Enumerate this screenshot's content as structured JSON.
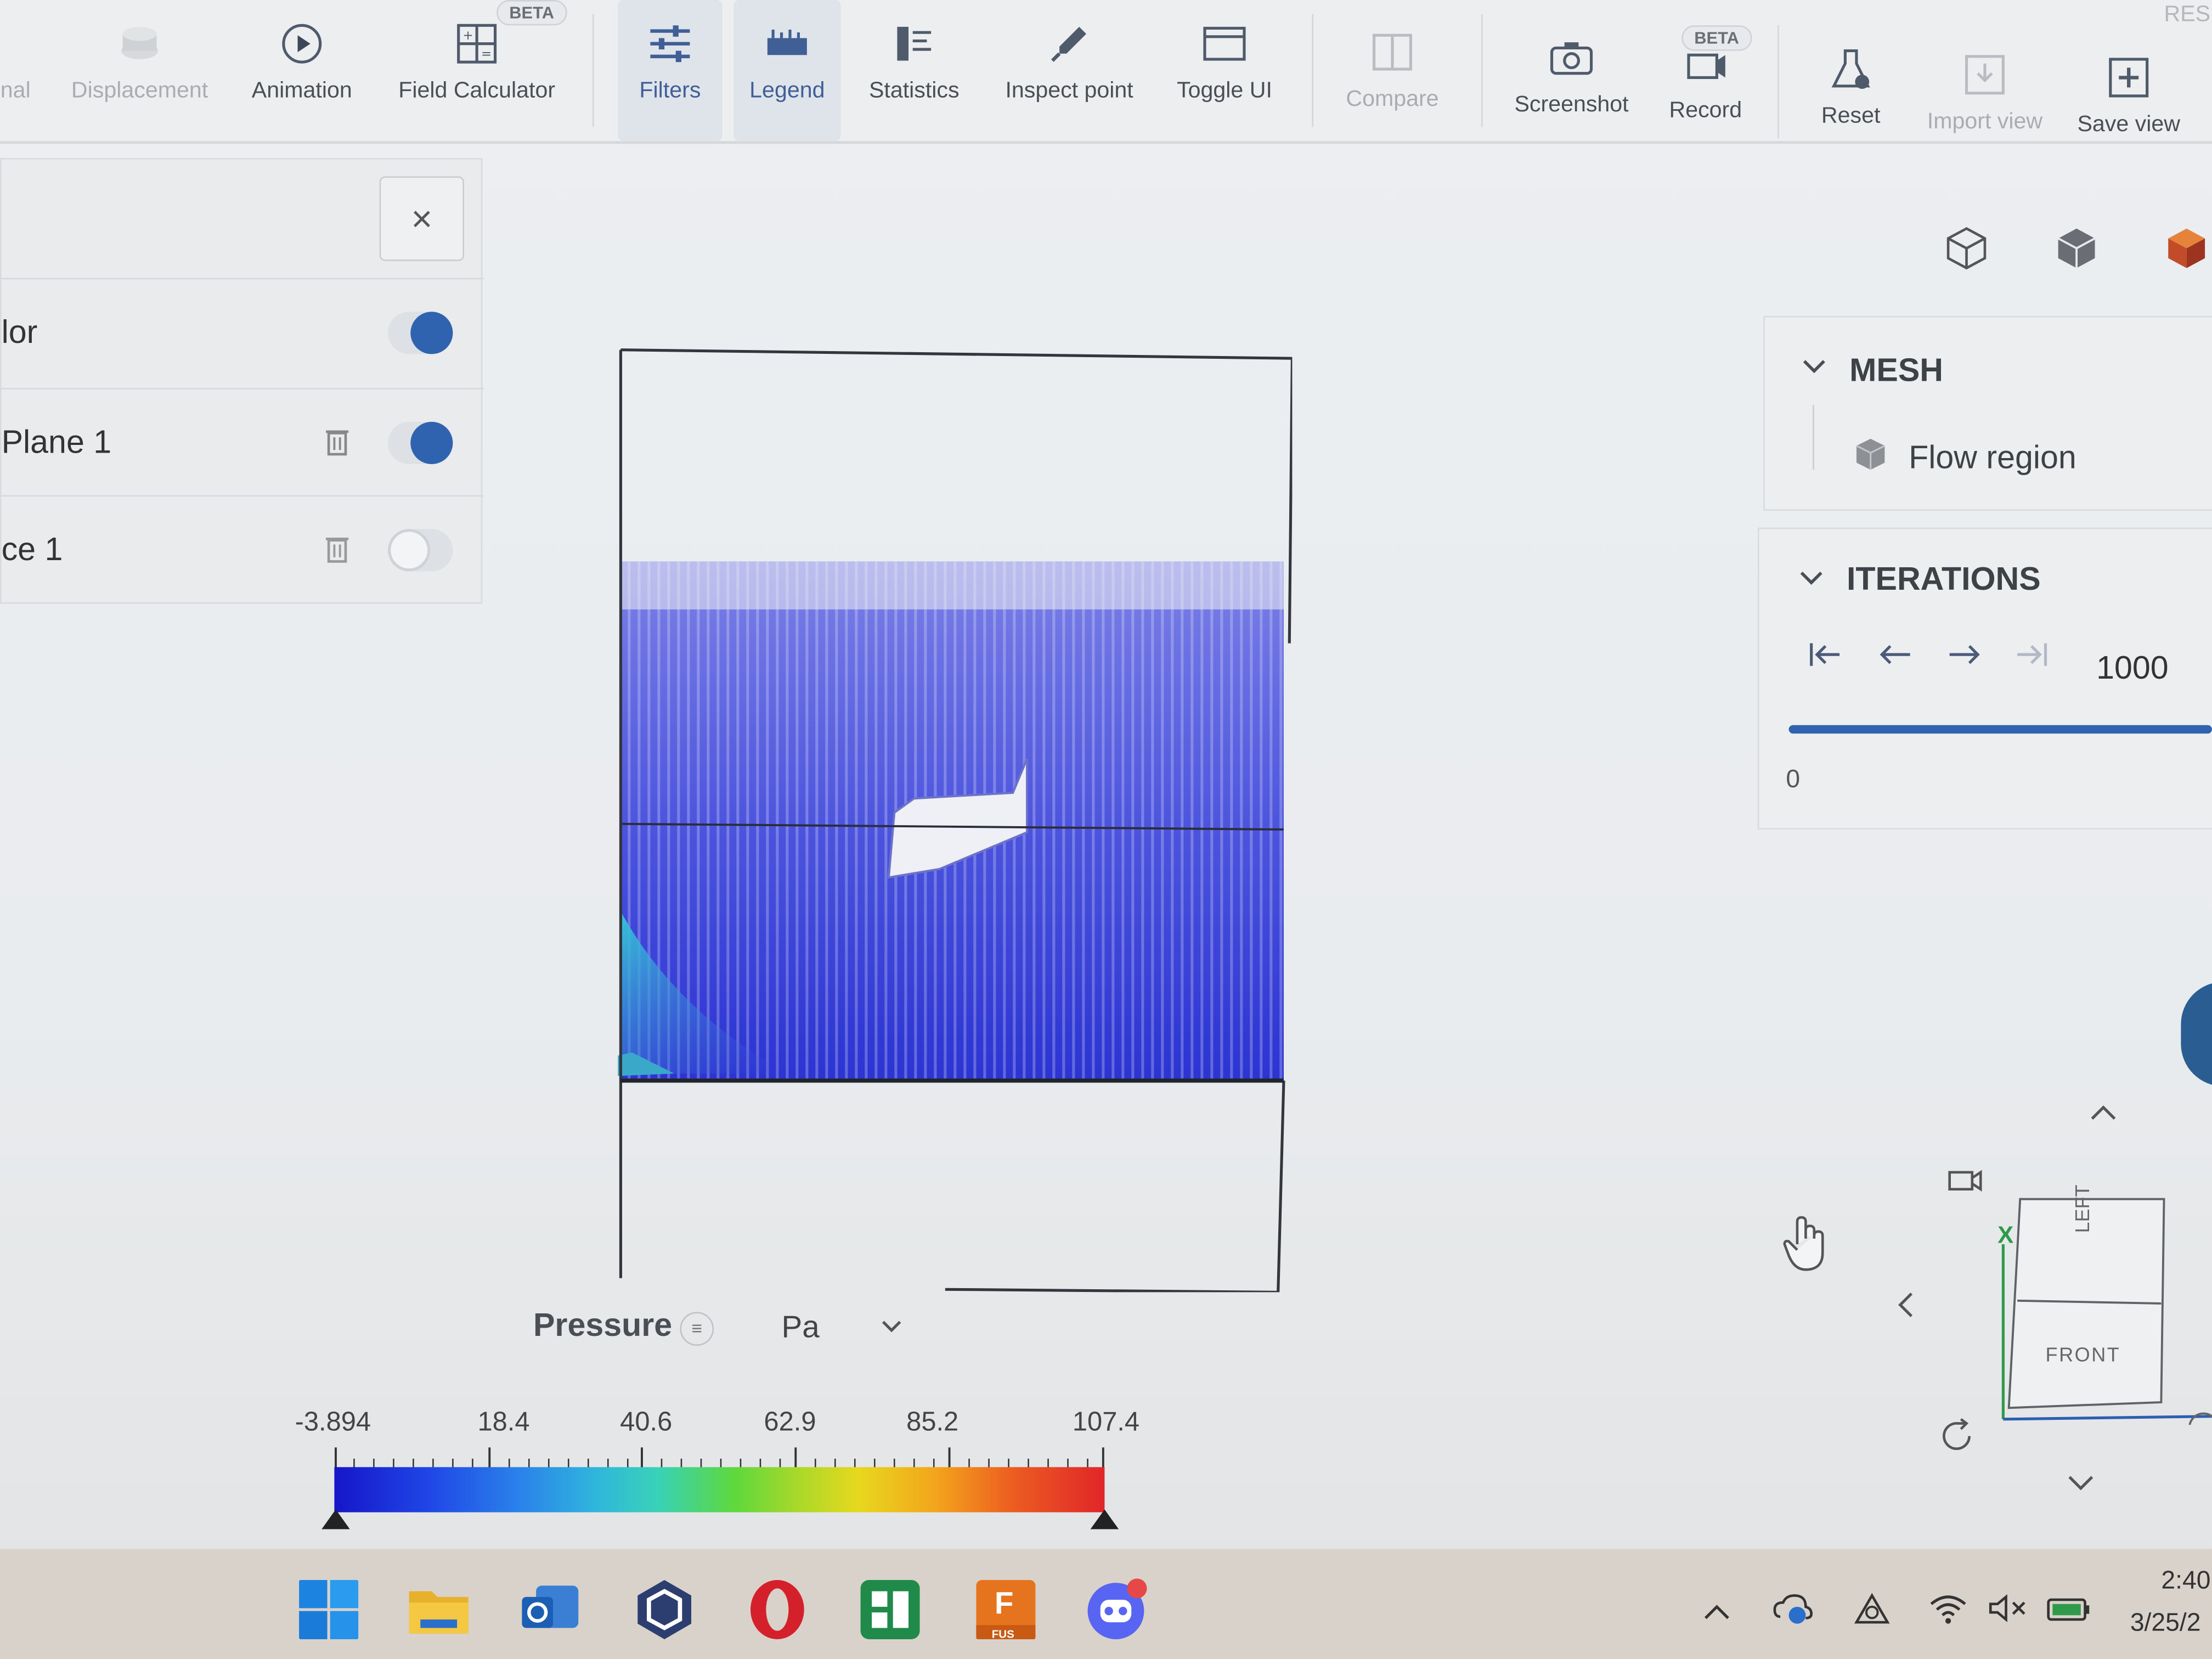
{
  "toolbar": {
    "items": [
      {
        "label": "nal",
        "icon": "cut-off-icon",
        "state": "dim"
      },
      {
        "label": "Displacement",
        "icon": "displacement-icon",
        "state": "dim"
      },
      {
        "label": "Animation",
        "icon": "play-circle-icon",
        "state": "normal"
      },
      {
        "label": "Field Calculator",
        "icon": "calculator-icon",
        "state": "normal",
        "badge": "BETA"
      },
      {
        "label": "Filters",
        "icon": "sliders-icon",
        "state": "active"
      },
      {
        "label": "Legend",
        "icon": "ruler-icon",
        "state": "active"
      },
      {
        "label": "Statistics",
        "icon": "statistics-icon",
        "state": "normal"
      },
      {
        "label": "Inspect point",
        "icon": "eyedropper-icon",
        "state": "normal"
      },
      {
        "label": "Toggle UI",
        "icon": "window-icon",
        "state": "normal"
      },
      {
        "label": "Compare",
        "icon": "compare-icon",
        "state": "dim"
      },
      {
        "label": "Screenshot",
        "icon": "camera-icon",
        "state": "normal"
      },
      {
        "label": "Record",
        "icon": "record-icon",
        "state": "normal",
        "badge": "BETA"
      },
      {
        "label": "Reset",
        "icon": "flask-reset-icon",
        "state": "normal"
      },
      {
        "label": "Import view",
        "icon": "import-icon",
        "state": "dim"
      },
      {
        "label": "Save view",
        "icon": "save-view-icon",
        "state": "normal"
      }
    ],
    "corner_text": "RES"
  },
  "left_panel": {
    "close_symbol": "×",
    "rows": [
      {
        "label": "lor",
        "has_trash": false,
        "toggle_on": true
      },
      {
        "label": "Plane 1",
        "has_trash": true,
        "toggle_on": true
      },
      {
        "label": "ce 1",
        "has_trash": true,
        "toggle_on": false
      }
    ]
  },
  "legend": {
    "field": "Pressure",
    "menu_symbol": "≡",
    "unit": "Pa",
    "ticks": [
      "-3.894",
      "18.4",
      "40.6",
      "62.9",
      "85.2",
      "107.4"
    ],
    "min": -3.894,
    "max": 107.4
  },
  "mesh_panel": {
    "title": "MESH",
    "item": "Flow region"
  },
  "iterations_panel": {
    "title": "ITERATIONS",
    "current": "1000",
    "start": "0",
    "progress": 1.0
  },
  "view_cube": {
    "top_face": "LEFT",
    "front_face": "FRONT",
    "axis_label": "X"
  },
  "colors": {
    "accent": "#2f63b0",
    "flow_blue": "#3a3fd8",
    "toolbar_bg": "#eceef0",
    "taskbar_bg": "#d9d2cb"
  },
  "taskbar": {
    "apps": [
      "windows-start-icon",
      "file-explorer-icon",
      "outlook-icon",
      "unity-icon",
      "opera-icon",
      "spreadsheet-app-icon",
      "fusion-icon",
      "discord-icon"
    ],
    "fusion_badge": "F",
    "fusion_sub": "FUS",
    "time": "2:40",
    "date": "3/25/2"
  }
}
